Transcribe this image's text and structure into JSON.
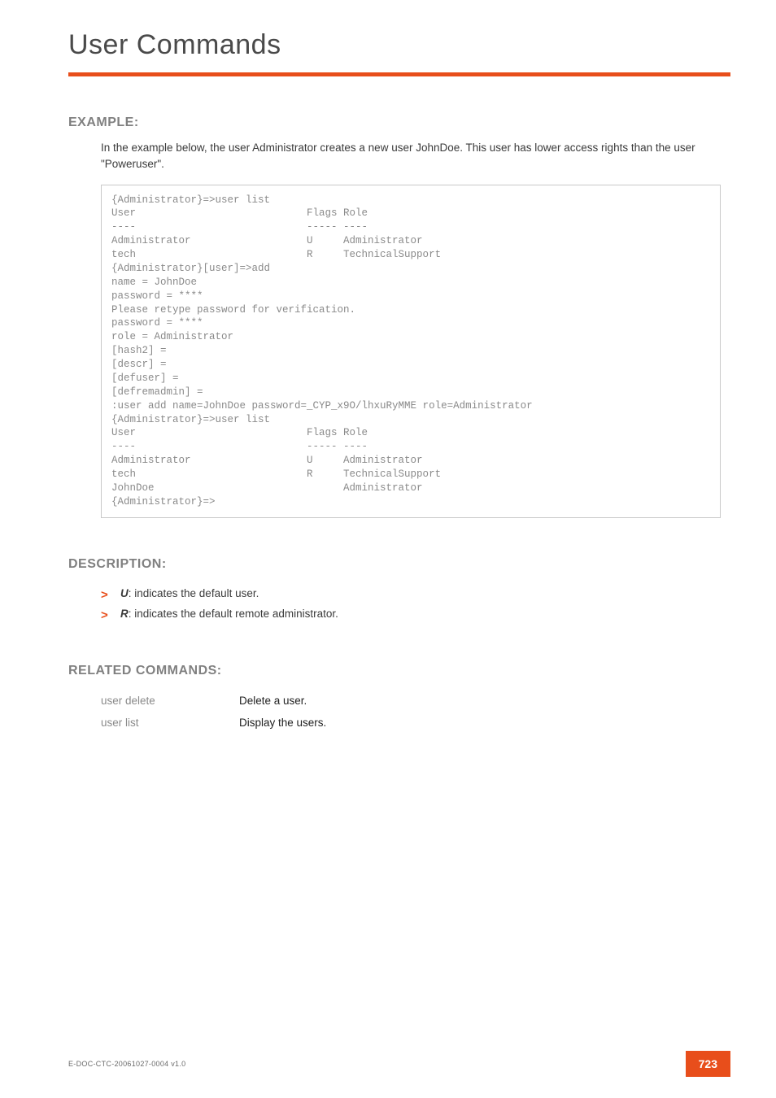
{
  "header": {
    "title": "User Commands"
  },
  "example": {
    "heading": "EXAMPLE:",
    "intro": "In the example below, the user Administrator creates a new user JohnDoe. This user has lower access rights than the user \"Poweruser\".",
    "terminal": "{Administrator}=>user list\nUser                            Flags Role\n----                            ----- ----\nAdministrator                   U     Administrator\ntech                            R     TechnicalSupport\n{Administrator}[user]=>add\nname = JohnDoe\npassword = ****\nPlease retype password for verification.\npassword = ****\nrole = Administrator\n[hash2] =\n[descr] =\n[defuser] =\n[defremadmin] =\n:user add name=JohnDoe password=_CYP_x9O/lhxuRyMME role=Administrator\n{Administrator}=>user list\nUser                            Flags Role\n----                            ----- ----\nAdministrator                   U     Administrator\ntech                            R     TechnicalSupport\nJohnDoe                               Administrator\n{Administrator}=>"
  },
  "description": {
    "heading": "DESCRIPTION:",
    "items": [
      {
        "em": "U",
        "text": ": indicates the default user."
      },
      {
        "em": "R",
        "text": ": indicates the default remote administrator."
      }
    ]
  },
  "related": {
    "heading": "RELATED COMMANDS:",
    "rows": [
      {
        "cmd": "user delete",
        "desc": "Delete a user."
      },
      {
        "cmd": "user list",
        "desc": "Display the users."
      }
    ]
  },
  "footer": {
    "doc": "E-DOC-CTC-20061027-0004 v1.0",
    "page": "723"
  }
}
